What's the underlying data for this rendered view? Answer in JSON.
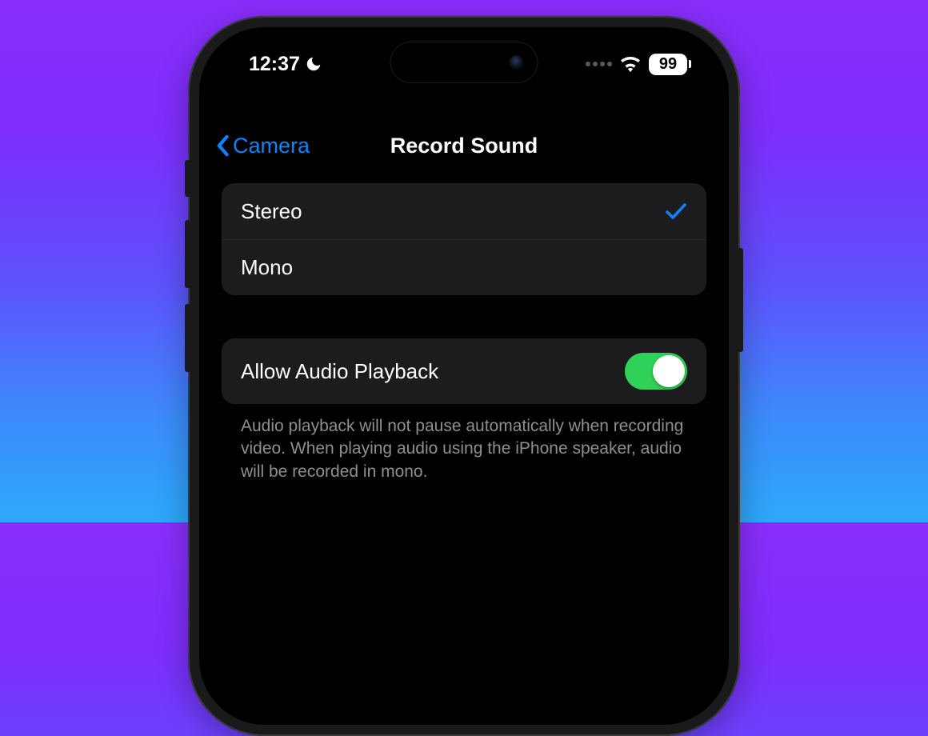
{
  "status": {
    "time": "12:37",
    "battery": "99"
  },
  "nav": {
    "back_label": "Camera",
    "title": "Record Sound"
  },
  "options": {
    "stereo": "Stereo",
    "mono": "Mono"
  },
  "playback": {
    "label": "Allow Audio Playback",
    "footer": "Audio playback will not pause automatically when recording video. When playing audio using the iPhone speaker, audio will be recorded in mono."
  }
}
